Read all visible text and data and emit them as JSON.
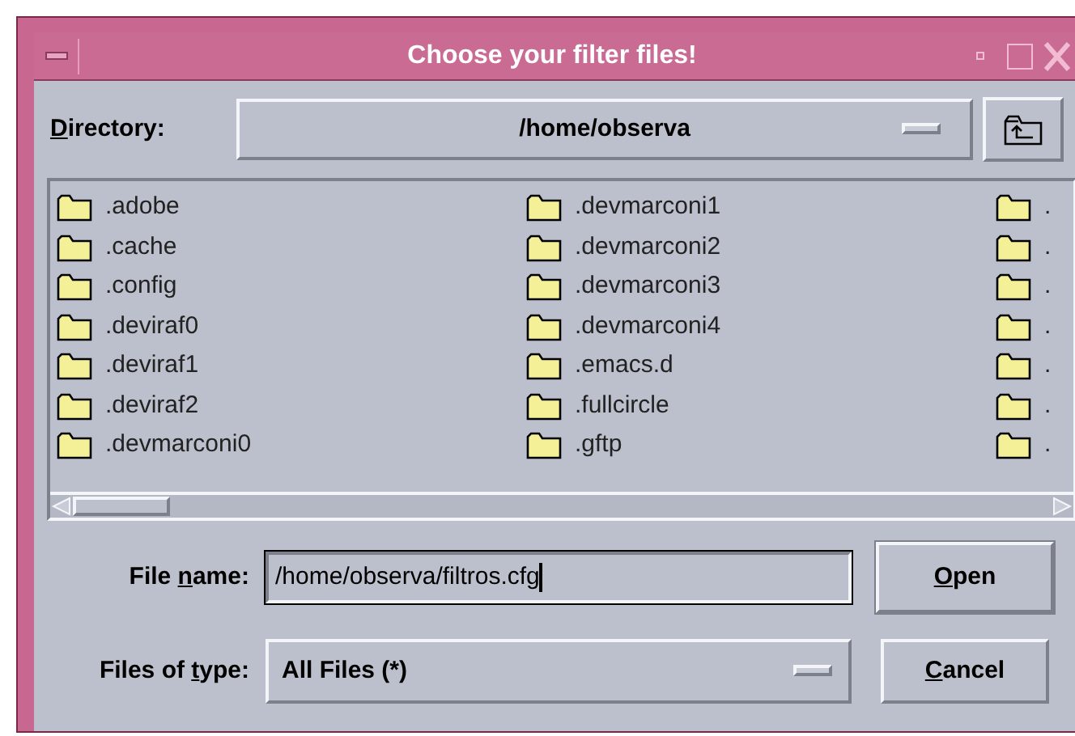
{
  "window": {
    "title": "Choose your filter files!"
  },
  "directory": {
    "label": {
      "key": "D",
      "after": "irectory:"
    },
    "value": "/home/observa"
  },
  "file_columns": [
    {
      "items": [
        ".adobe",
        ".cache",
        ".config",
        ".deviraf0",
        ".deviraf1",
        ".deviraf2",
        ".devmarconi0"
      ]
    },
    {
      "items": [
        ".devmarconi1",
        ".devmarconi2",
        ".devmarconi3",
        ".devmarconi4",
        ".emacs.d",
        ".fullcircle",
        ".gftp"
      ]
    },
    {
      "items": [
        ".",
        ".",
        ".",
        ".",
        ".",
        ".",
        "."
      ]
    }
  ],
  "file_name": {
    "label": {
      "before": "File ",
      "key": "n",
      "after": "ame:"
    },
    "value": "/home/observa/filtros.cfg"
  },
  "file_type": {
    "label": {
      "before": "Files of ",
      "key": "t",
      "after": "ype:"
    },
    "value": "All Files (*)"
  },
  "buttons": [
    {
      "key": "O",
      "after": "pen"
    },
    {
      "key": "C",
      "after": "ancel"
    }
  ]
}
